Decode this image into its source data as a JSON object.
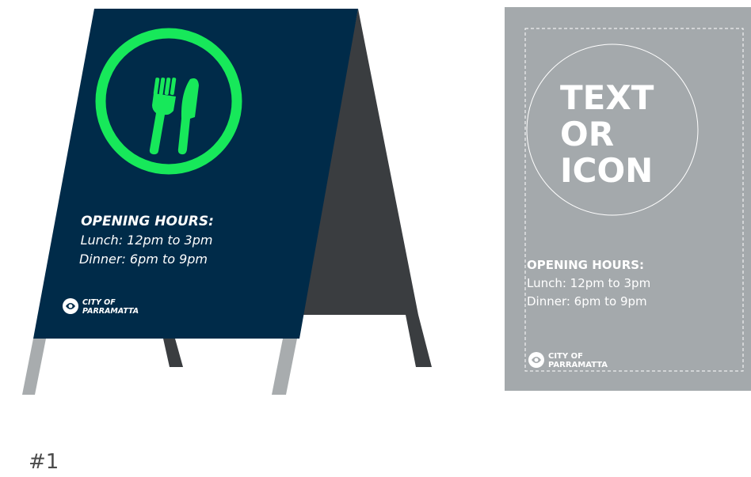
{
  "sandwich_board": {
    "opening_hours_label": "OPENING HOURS:",
    "lunch_line": "Lunch: 12pm to 3pm",
    "dinner_line": "Dinner: 6pm to 9pm",
    "logo_text_line1": "CITY OF",
    "logo_text_line2": "PARRAMATTA",
    "icon": "fork-and-knife-icon",
    "colors": {
      "panel": "#002b49",
      "accent": "#17e85a",
      "back_panel": "#3a3d40",
      "legs": "#a8acae"
    }
  },
  "template": {
    "placeholder_line1": "TEXT",
    "placeholder_line2": "OR",
    "placeholder_line3": "ICON",
    "opening_hours_label": "OPENING HOURS:",
    "lunch_line": "Lunch: 12pm to 3pm",
    "dinner_line": "Dinner: 6pm to 9pm",
    "logo_text_line1": "CITY OF",
    "logo_text_line2": "PARRAMATTA",
    "colors": {
      "panel": "#a4a9ac",
      "text": "#ffffff"
    }
  },
  "caption": "#1"
}
